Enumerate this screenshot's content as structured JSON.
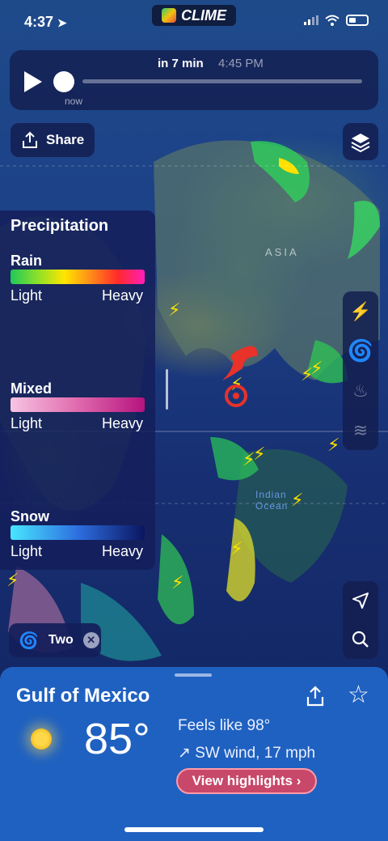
{
  "status_bar": {
    "time": "4:37"
  },
  "brand": {
    "name": "CLIME"
  },
  "timeline": {
    "label": "in 7 min",
    "time": "4:45 PM",
    "now_label": "now"
  },
  "share": {
    "label": "Share"
  },
  "map": {
    "region_label": "ASIA",
    "ocean_label": "Indian Ocean"
  },
  "legend": {
    "title": "Precipitation",
    "items": [
      {
        "name": "Rain",
        "light": "Light",
        "heavy": "Heavy",
        "colors": [
          "#1fc95a",
          "#ffe600",
          "#ff2a2a",
          "#ff1fb8"
        ]
      },
      {
        "name": "Mixed",
        "light": "Light",
        "heavy": "Heavy",
        "colors": [
          "#f7c4e2",
          "#e06aae",
          "#b5137e"
        ]
      },
      {
        "name": "Snow",
        "light": "Light",
        "heavy": "Heavy",
        "colors": [
          "#48e6ff",
          "#2d6fe0",
          "#0b1560"
        ]
      }
    ]
  },
  "storm_chip": {
    "label": "Two"
  },
  "location": {
    "name": "Gulf of Mexico",
    "temperature": "85°",
    "feels_like": "Feels like 98°",
    "wind": "↗ SW wind, 17 mph",
    "highlights_label": "View highlights ›"
  },
  "colors": {
    "sheet": "#1f61c1",
    "accent_button": "#c8486a",
    "storm": "#e8322a"
  }
}
